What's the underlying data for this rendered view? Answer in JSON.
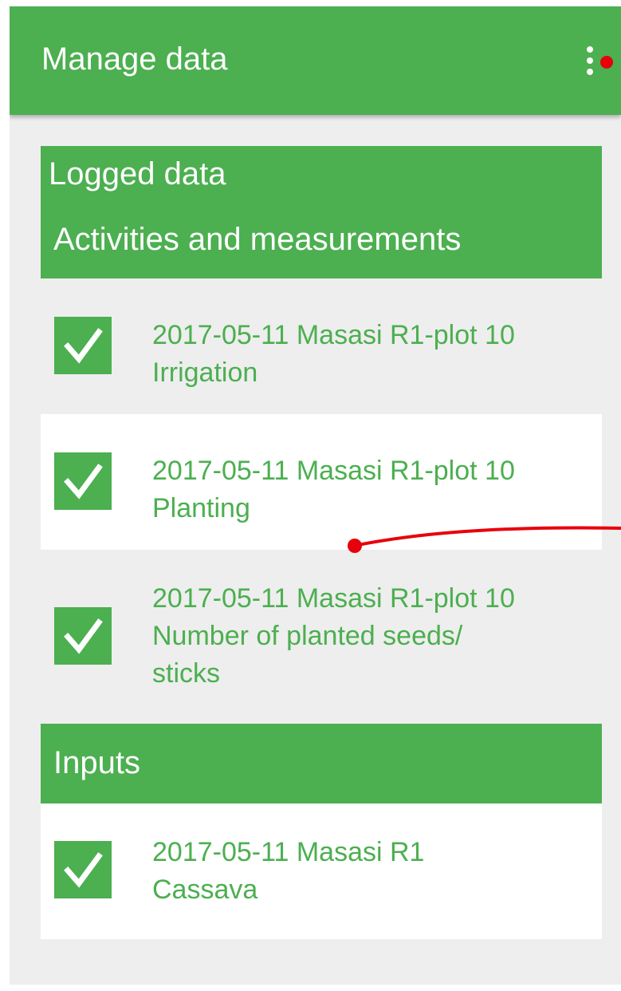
{
  "appbar": {
    "title": "Manage data",
    "menu_icon": "more-vert-icon"
  },
  "logged": {
    "title": "Logged data",
    "subtitle": "Activities and measurements",
    "items": [
      {
        "checked": true,
        "line1": "2017-05-11 Masasi R1-plot 10",
        "line2": "Irrigation",
        "line3": ""
      },
      {
        "checked": true,
        "line1": "2017-05-11 Masasi R1-plot 10",
        "line2": "Planting",
        "line3": ""
      },
      {
        "checked": true,
        "line1": "2017-05-11 Masasi R1-plot 10",
        "line2": "Number of planted seeds/",
        "line3": "sticks"
      }
    ]
  },
  "inputs": {
    "title": "Inputs",
    "items": [
      {
        "checked": true,
        "line1": "2017-05-11 Masasi R1",
        "line2": "Cassava"
      }
    ]
  },
  "colors": {
    "accent": "#4caf50",
    "background": "#eeeeee",
    "annotation": "#e8000b"
  }
}
